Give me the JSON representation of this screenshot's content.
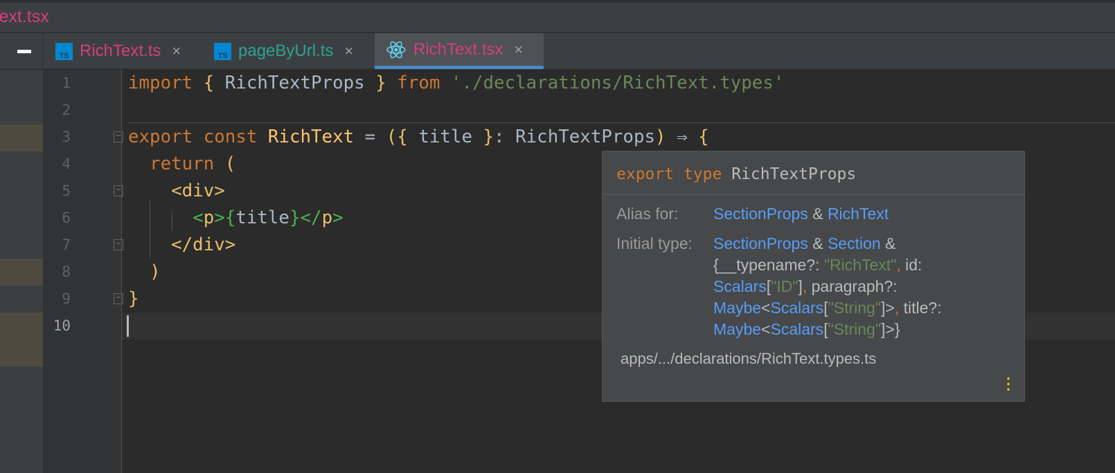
{
  "window": {
    "title": "Text.tsx"
  },
  "tabs": [
    {
      "label": "RichText.ts",
      "icon": "typescript-icon",
      "color": "#d63d80"
    },
    {
      "label": "pageByUrl.ts",
      "icon": "typescript-icon",
      "color": "#2ba393"
    },
    {
      "label": "RichText.tsx",
      "icon": "react-icon",
      "color": "#d63d80",
      "active": true
    }
  ],
  "tab_close": "×",
  "ts_badge": "TS",
  "editor": {
    "line_numbers": [
      "1",
      "2",
      "3",
      "4",
      "5",
      "6",
      "7",
      "8",
      "9",
      "10"
    ],
    "current_line": "10"
  },
  "popup": {
    "kw1": "export",
    "kw2": "type",
    "name": "RichTextProps",
    "alias_label": "Alias for:",
    "alias": {
      "a": "SectionProps",
      "amp": "&",
      "b": "RichText"
    },
    "initial_label": "Initial type:",
    "initial": {
      "t1": "SectionProps",
      "t2": "Section",
      "amp": "&",
      "typename": "{__typename?: ",
      "str1": "\"RichText\"",
      "comma": ",",
      "id": " id:",
      "scalars": "Scalars",
      "lb": "[",
      "id_str": "\"ID\"",
      "rb": "]",
      "paragraph": " paragraph?:",
      "maybe": "Maybe",
      "lt": "<",
      "string_str": "\"String\"",
      "gt_close": "]>",
      "title": " title?:",
      "end": "]>}"
    },
    "path": "apps/.../declarations/RichText.types.ts",
    "more_icon": "more-vertical-icon"
  },
  "colors": {
    "accent": "#4a88c7",
    "keyword": "#cc7832",
    "link": "#589df6"
  }
}
